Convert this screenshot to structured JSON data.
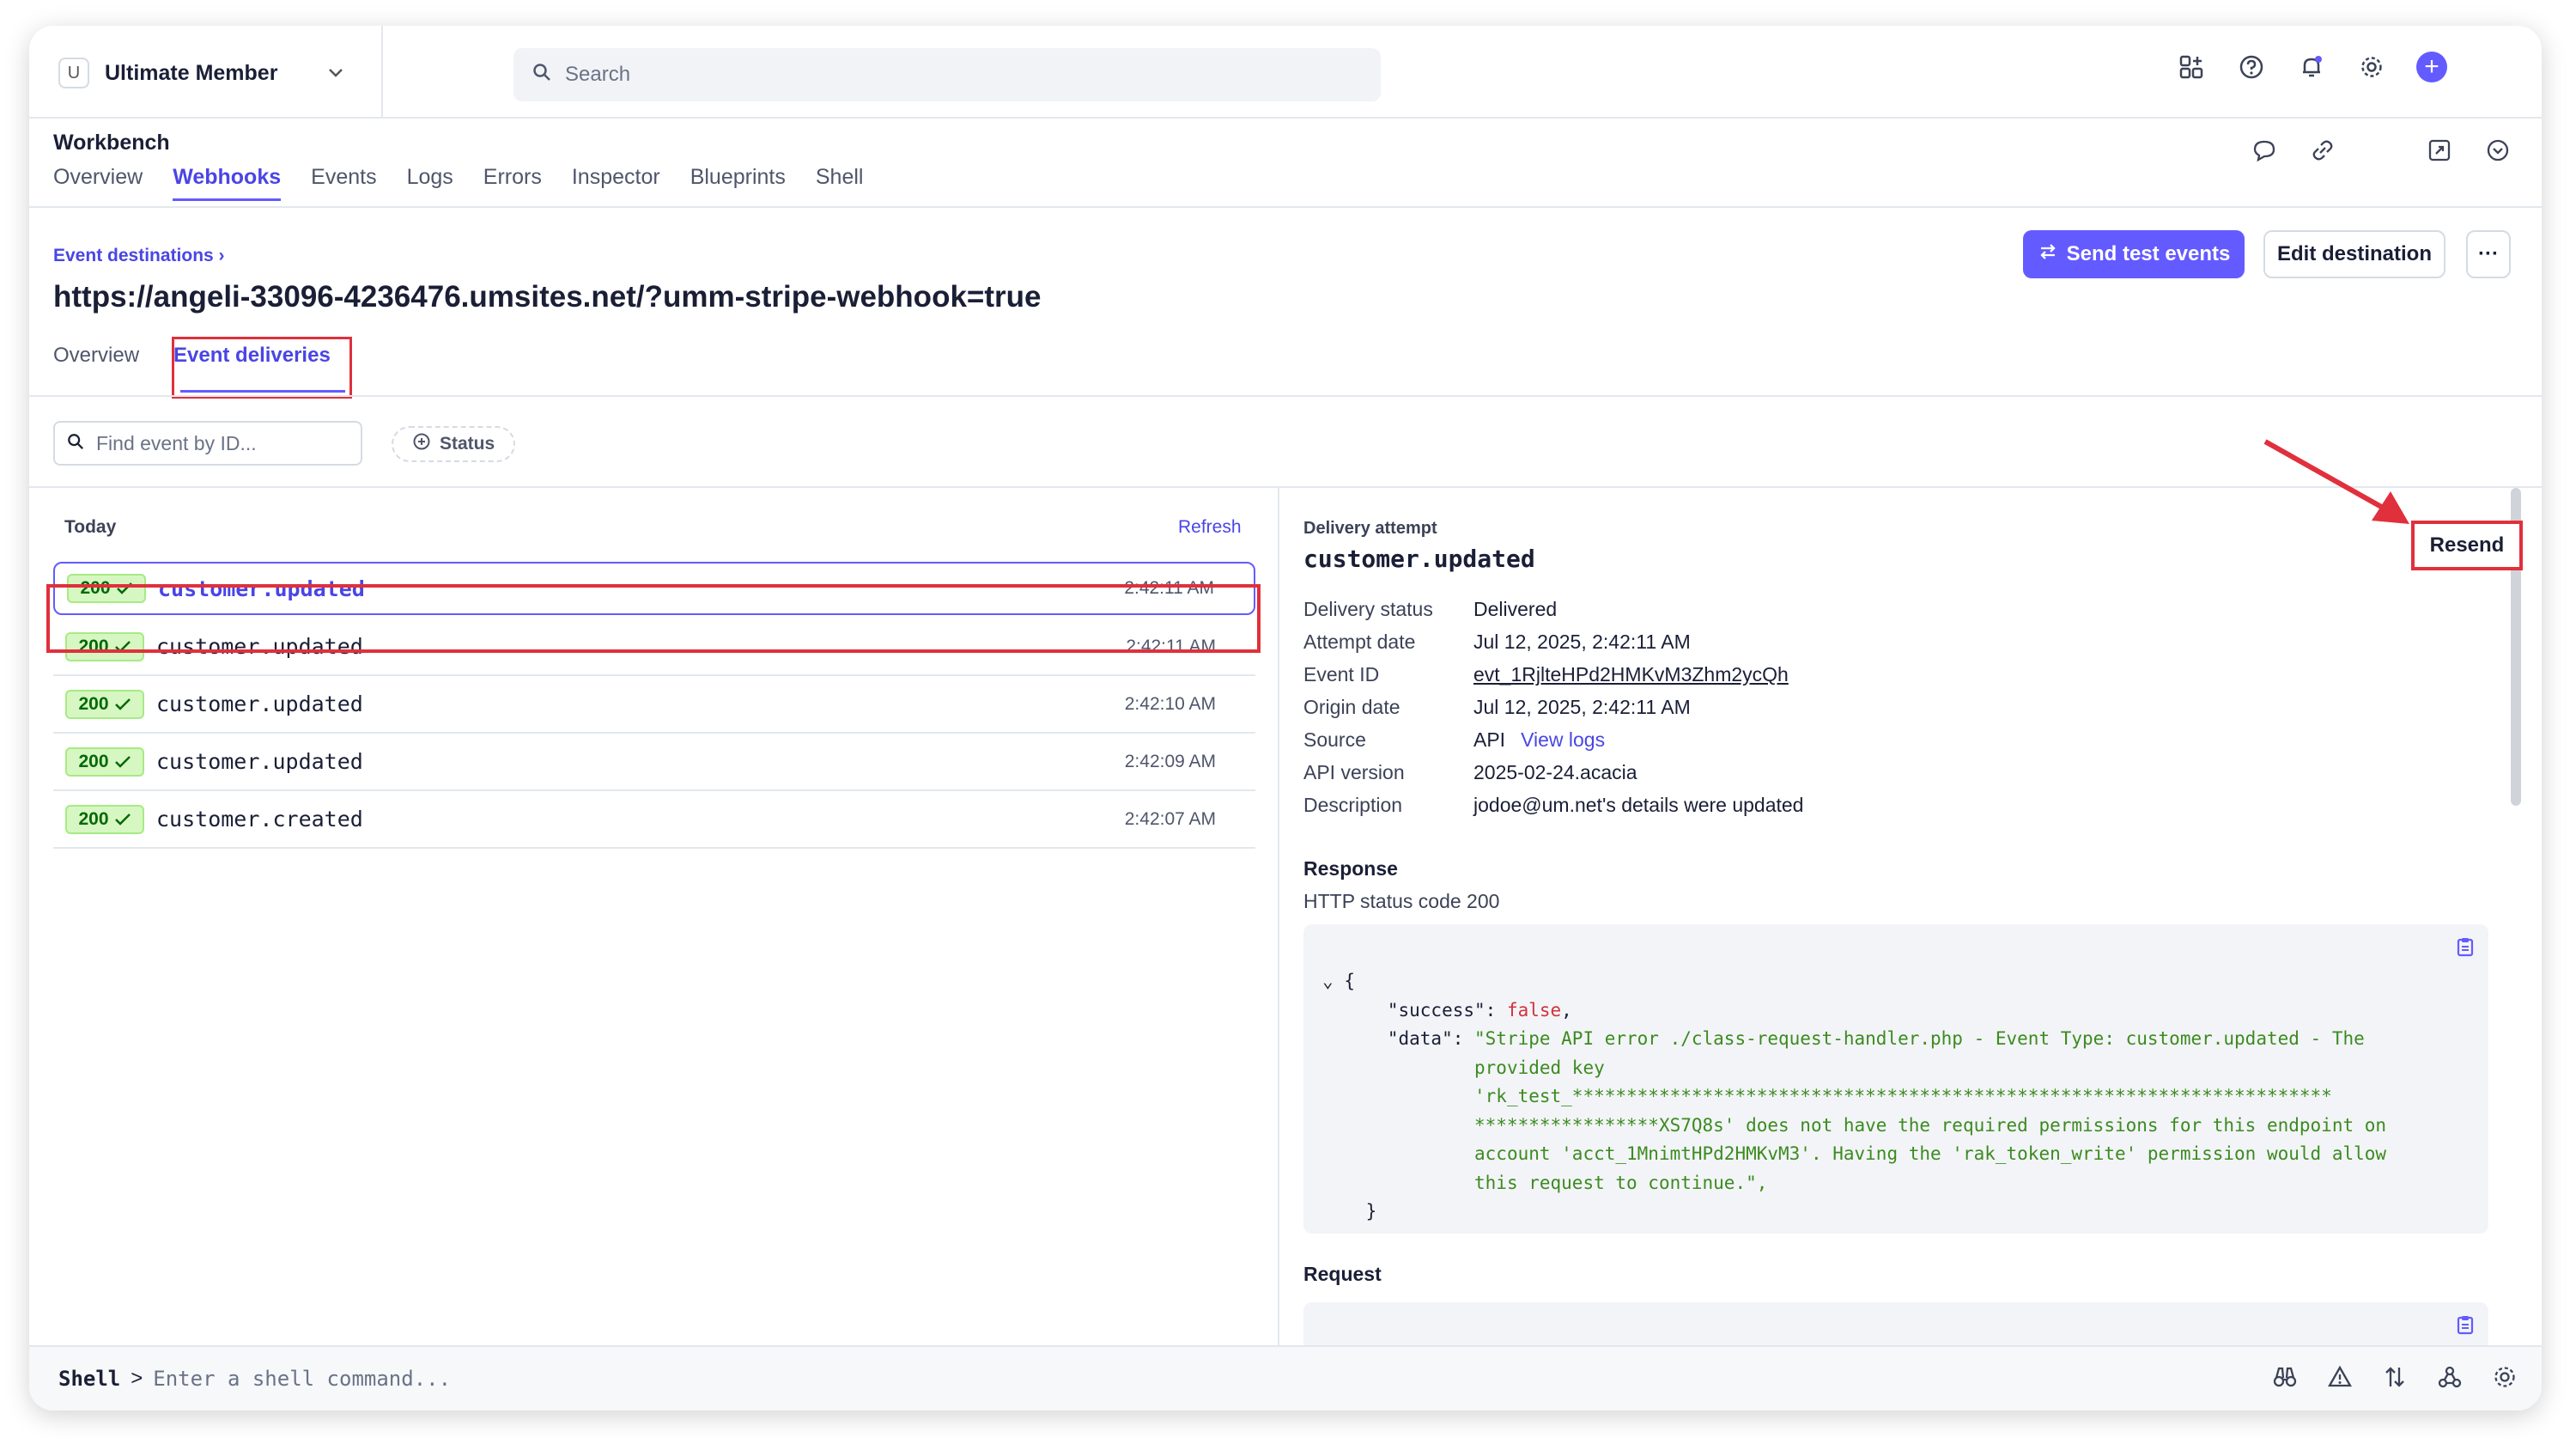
{
  "topbar": {
    "account_badge": "U",
    "account_name": "Ultimate Member",
    "search_placeholder": "Search"
  },
  "workbench": {
    "title": "Workbench",
    "tabs": [
      "Overview",
      "Webhooks",
      "Events",
      "Logs",
      "Errors",
      "Inspector",
      "Blueprints",
      "Shell"
    ],
    "active_tab": "Webhooks"
  },
  "destination": {
    "breadcrumb": "Event destinations",
    "url": "https://angeli-33096-4236476.umsites.net/?umm-stripe-webhook=true",
    "send_test_label": "Send test events",
    "edit_label": "Edit destination",
    "more_label": "···",
    "subtabs": [
      "Overview",
      "Event deliveries"
    ],
    "active_subtab": "Event deliveries"
  },
  "filters": {
    "find_placeholder": "Find event by ID...",
    "status_label": "Status"
  },
  "list": {
    "group_label": "Today",
    "refresh_label": "Refresh",
    "rows": [
      {
        "code": "200",
        "event": "customer.updated",
        "time": "2:42:11 AM",
        "selected": true
      },
      {
        "code": "200",
        "event": "customer.updated",
        "time": "2:42:11 AM",
        "selected": false
      },
      {
        "code": "200",
        "event": "customer.updated",
        "time": "2:42:10 AM",
        "selected": false
      },
      {
        "code": "200",
        "event": "customer.updated",
        "time": "2:42:09 AM",
        "selected": false
      },
      {
        "code": "200",
        "event": "customer.created",
        "time": "2:42:07 AM",
        "selected": false
      }
    ]
  },
  "detail": {
    "section_label": "Delivery attempt",
    "event_name": "customer.updated",
    "resend_label": "Resend",
    "fields": {
      "delivery_status": {
        "key": "Delivery status",
        "value": "Delivered"
      },
      "attempt_date": {
        "key": "Attempt date",
        "value": "Jul 12, 2025, 2:42:11 AM"
      },
      "event_id": {
        "key": "Event ID",
        "value": "evt_1RjlteHPd2HMKvM3Zhm2ycQh"
      },
      "origin_date": {
        "key": "Origin date",
        "value": "Jul 12, 2025, 2:42:11 AM"
      },
      "source": {
        "key": "Source",
        "value": "API",
        "link": "View logs"
      },
      "api_version": {
        "key": "API version",
        "value": "2025-02-24.acacia"
      },
      "description": {
        "key": "Description",
        "value": "jodoe@um.net's details were updated"
      }
    },
    "response_heading": "Response",
    "response_status": "HTTP status code 200",
    "response_json": {
      "open": "{",
      "success_key": "\"success\"",
      "success_value": "false",
      "data_key": "\"data\"",
      "data_lines": [
        "\"Stripe API error ./class-request-handler.php - Event Type: customer.updated - The",
        "provided key",
        "'rk_test_**********************************************************************",
        "*****************XS7Q8s' does not have the required permissions for this endpoint on",
        "account 'acct_1MnimtHPd2HMKvM3'. Having the 'rak_token_write' permission would allow",
        "this request to continue.\","
      ],
      "close": "}"
    },
    "request_heading": "Request"
  },
  "shell": {
    "label": "Shell",
    "prompt": ">",
    "placeholder": "Enter a shell command..."
  },
  "colors": {
    "accent": "#635bff",
    "annotation_red": "#e0303c",
    "success_bg": "#d7f7c2",
    "success_text": "#006908"
  }
}
